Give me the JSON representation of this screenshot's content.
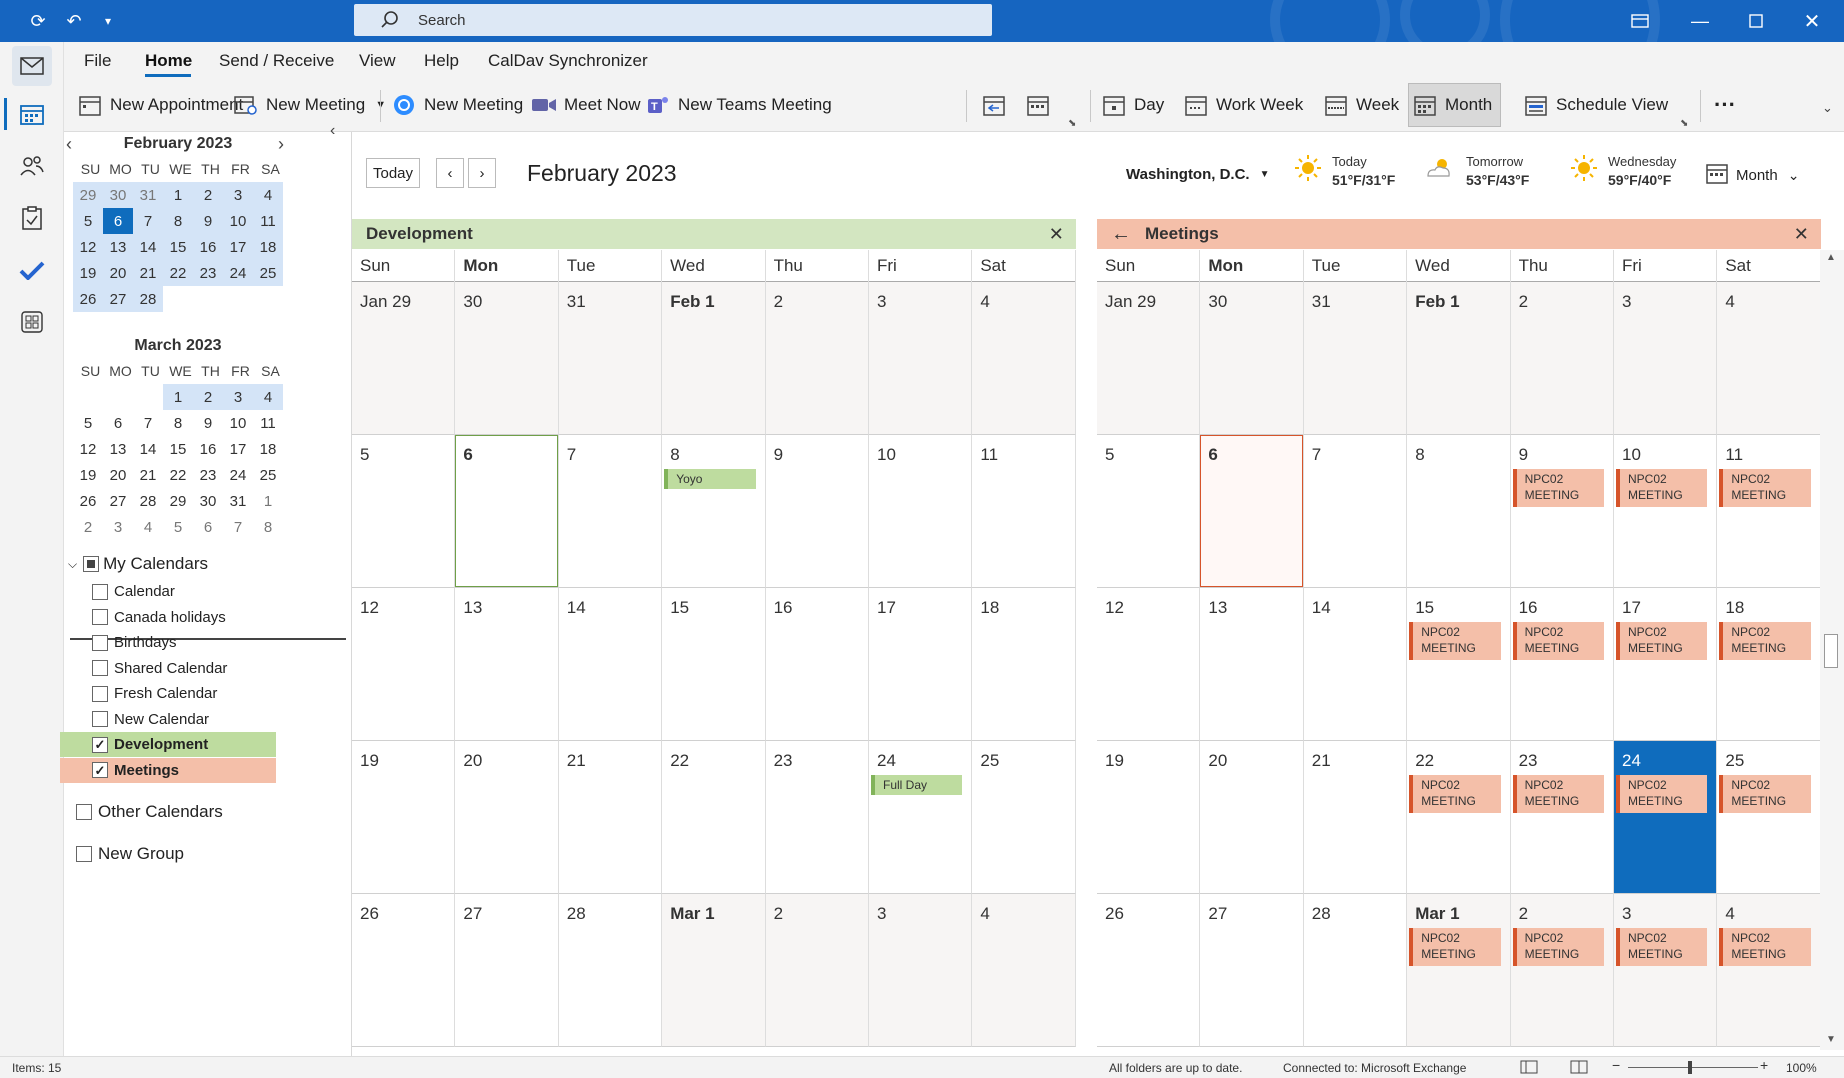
{
  "titlebar": {
    "search_placeholder": "Search"
  },
  "menu": [
    "File",
    "Home",
    "Send / Receive",
    "View",
    "Help",
    "CalDav Synchronizer"
  ],
  "ribbon": {
    "new_appointment": "New Appointment",
    "new_meeting": "New Meeting",
    "new_meeting_2": "New Meeting",
    "meet_now": "Meet Now",
    "new_teams_meeting": "New Teams Meeting",
    "day": "Day",
    "work_week": "Work Week",
    "week": "Week",
    "month": "Month",
    "schedule_view": "Schedule View",
    "more": "···"
  },
  "mini_calendars": [
    {
      "title": "February 2023",
      "dow": [
        "SU",
        "MO",
        "TU",
        "WE",
        "TH",
        "FR",
        "SA"
      ],
      "weeks": [
        [
          "29",
          "30",
          "31",
          "1",
          "2",
          "3",
          "4"
        ],
        [
          "5",
          "6",
          "7",
          "8",
          "9",
          "10",
          "11"
        ],
        [
          "12",
          "13",
          "14",
          "15",
          "16",
          "17",
          "18"
        ],
        [
          "19",
          "20",
          "21",
          "22",
          "23",
          "24",
          "25"
        ],
        [
          "26",
          "27",
          "28",
          "",
          "",
          "",
          ""
        ]
      ]
    },
    {
      "title": "March 2023",
      "dow": [
        "SU",
        "MO",
        "TU",
        "WE",
        "TH",
        "FR",
        "SA"
      ],
      "weeks": [
        [
          "",
          "",
          "",
          "1",
          "2",
          "3",
          "4"
        ],
        [
          "5",
          "6",
          "7",
          "8",
          "9",
          "10",
          "11"
        ],
        [
          "12",
          "13",
          "14",
          "15",
          "16",
          "17",
          "18"
        ],
        [
          "19",
          "20",
          "21",
          "22",
          "23",
          "24",
          "25"
        ],
        [
          "26",
          "27",
          "28",
          "29",
          "30",
          "31",
          "1"
        ],
        [
          "2",
          "3",
          "4",
          "5",
          "6",
          "7",
          "8"
        ]
      ]
    }
  ],
  "my_calendars": {
    "label": "My Calendars",
    "items": [
      {
        "label": "Calendar",
        "checked": false
      },
      {
        "label": "Canada holidays",
        "checked": false
      },
      {
        "label": "Birthdays",
        "checked": false
      },
      {
        "label": "Shared Calendar",
        "checked": false
      },
      {
        "label": "Fresh Calendar",
        "checked": false
      },
      {
        "label": "New Calendar",
        "checked": false
      },
      {
        "label": "Development",
        "checked": true,
        "color": "#bedc9f"
      },
      {
        "label": "Meetings",
        "checked": true,
        "color": "#f4bfa9"
      }
    ]
  },
  "other_calendars": "Other Calendars",
  "new_group": "New Group",
  "header": {
    "today": "Today",
    "month_title": "February 2023",
    "location": "Washington, D.C.",
    "view_select": "Month",
    "weather": [
      {
        "day": "Today",
        "temp": "51°F/31°F",
        "icon": "sun-icon"
      },
      {
        "day": "Tomorrow",
        "temp": "53°F/43°F",
        "icon": "partly-cloudy-icon"
      },
      {
        "day": "Wednesday",
        "temp": "59°F/40°F",
        "icon": "sun-icon"
      }
    ]
  },
  "dow_headers": [
    "Sun",
    "Mon",
    "Tue",
    "Wed",
    "Thu",
    "Fri",
    "Sat"
  ],
  "panels": [
    {
      "name": "Development",
      "color": "#d3e6c1",
      "weeks": [
        [
          "Jan 29",
          "30",
          "31",
          "Feb 1",
          "2",
          "3",
          "4"
        ],
        [
          "5",
          "6",
          "7",
          "8",
          "9",
          "10",
          "11"
        ],
        [
          "12",
          "13",
          "14",
          "15",
          "16",
          "17",
          "18"
        ],
        [
          "19",
          "20",
          "21",
          "22",
          "23",
          "24",
          "25"
        ],
        [
          "26",
          "27",
          "28",
          "Mar 1",
          "2",
          "3",
          "4"
        ]
      ],
      "events": [
        {
          "week": 1,
          "day": 3,
          "text": "Yoyo"
        },
        {
          "week": 3,
          "day": 5,
          "text": "Full Day"
        }
      ]
    },
    {
      "name": "Meetings",
      "color": "#f4bfa9",
      "weeks": [
        [
          "Jan 29",
          "30",
          "31",
          "Feb 1",
          "2",
          "3",
          "4"
        ],
        [
          "5",
          "6",
          "7",
          "8",
          "9",
          "10",
          "11"
        ],
        [
          "12",
          "13",
          "14",
          "15",
          "16",
          "17",
          "18"
        ],
        [
          "19",
          "20",
          "21",
          "22",
          "23",
          "24",
          "25"
        ],
        [
          "26",
          "27",
          "28",
          "Mar 1",
          "2",
          "3",
          "4"
        ]
      ],
      "events": [
        {
          "week": 1,
          "day": 4,
          "text": "NPC02 MEETING"
        },
        {
          "week": 1,
          "day": 5,
          "text": "NPC02 MEETING"
        },
        {
          "week": 1,
          "day": 6,
          "text": "NPC02 MEETING"
        },
        {
          "week": 2,
          "day": 3,
          "text": "NPC02 MEETING"
        },
        {
          "week": 2,
          "day": 4,
          "text": "NPC02 MEETING"
        },
        {
          "week": 2,
          "day": 5,
          "text": "NPC02 MEETING"
        },
        {
          "week": 2,
          "day": 6,
          "text": "NPC02 MEETING"
        },
        {
          "week": 3,
          "day": 3,
          "text": "NPC02 MEETING"
        },
        {
          "week": 3,
          "day": 4,
          "text": "NPC02 MEETING"
        },
        {
          "week": 3,
          "day": 5,
          "text": "NPC02 MEETING"
        },
        {
          "week": 3,
          "day": 6,
          "text": "NPC02 MEETING"
        },
        {
          "week": 4,
          "day": 3,
          "text": "NPC02 MEETING"
        },
        {
          "week": 4,
          "day": 4,
          "text": "NPC02 MEETING"
        },
        {
          "week": 4,
          "day": 5,
          "text": "NPC02 MEETING"
        },
        {
          "week": 4,
          "day": 6,
          "text": "NPC02 MEETING"
        }
      ]
    }
  ],
  "status": {
    "items": "Items: 15",
    "sync": "All folders are up to date.",
    "connection": "Connected to: Microsoft Exchange",
    "zoom": "100%"
  },
  "colors": {
    "accent": "#0f6cbd",
    "titlebar": "#1665c0"
  }
}
